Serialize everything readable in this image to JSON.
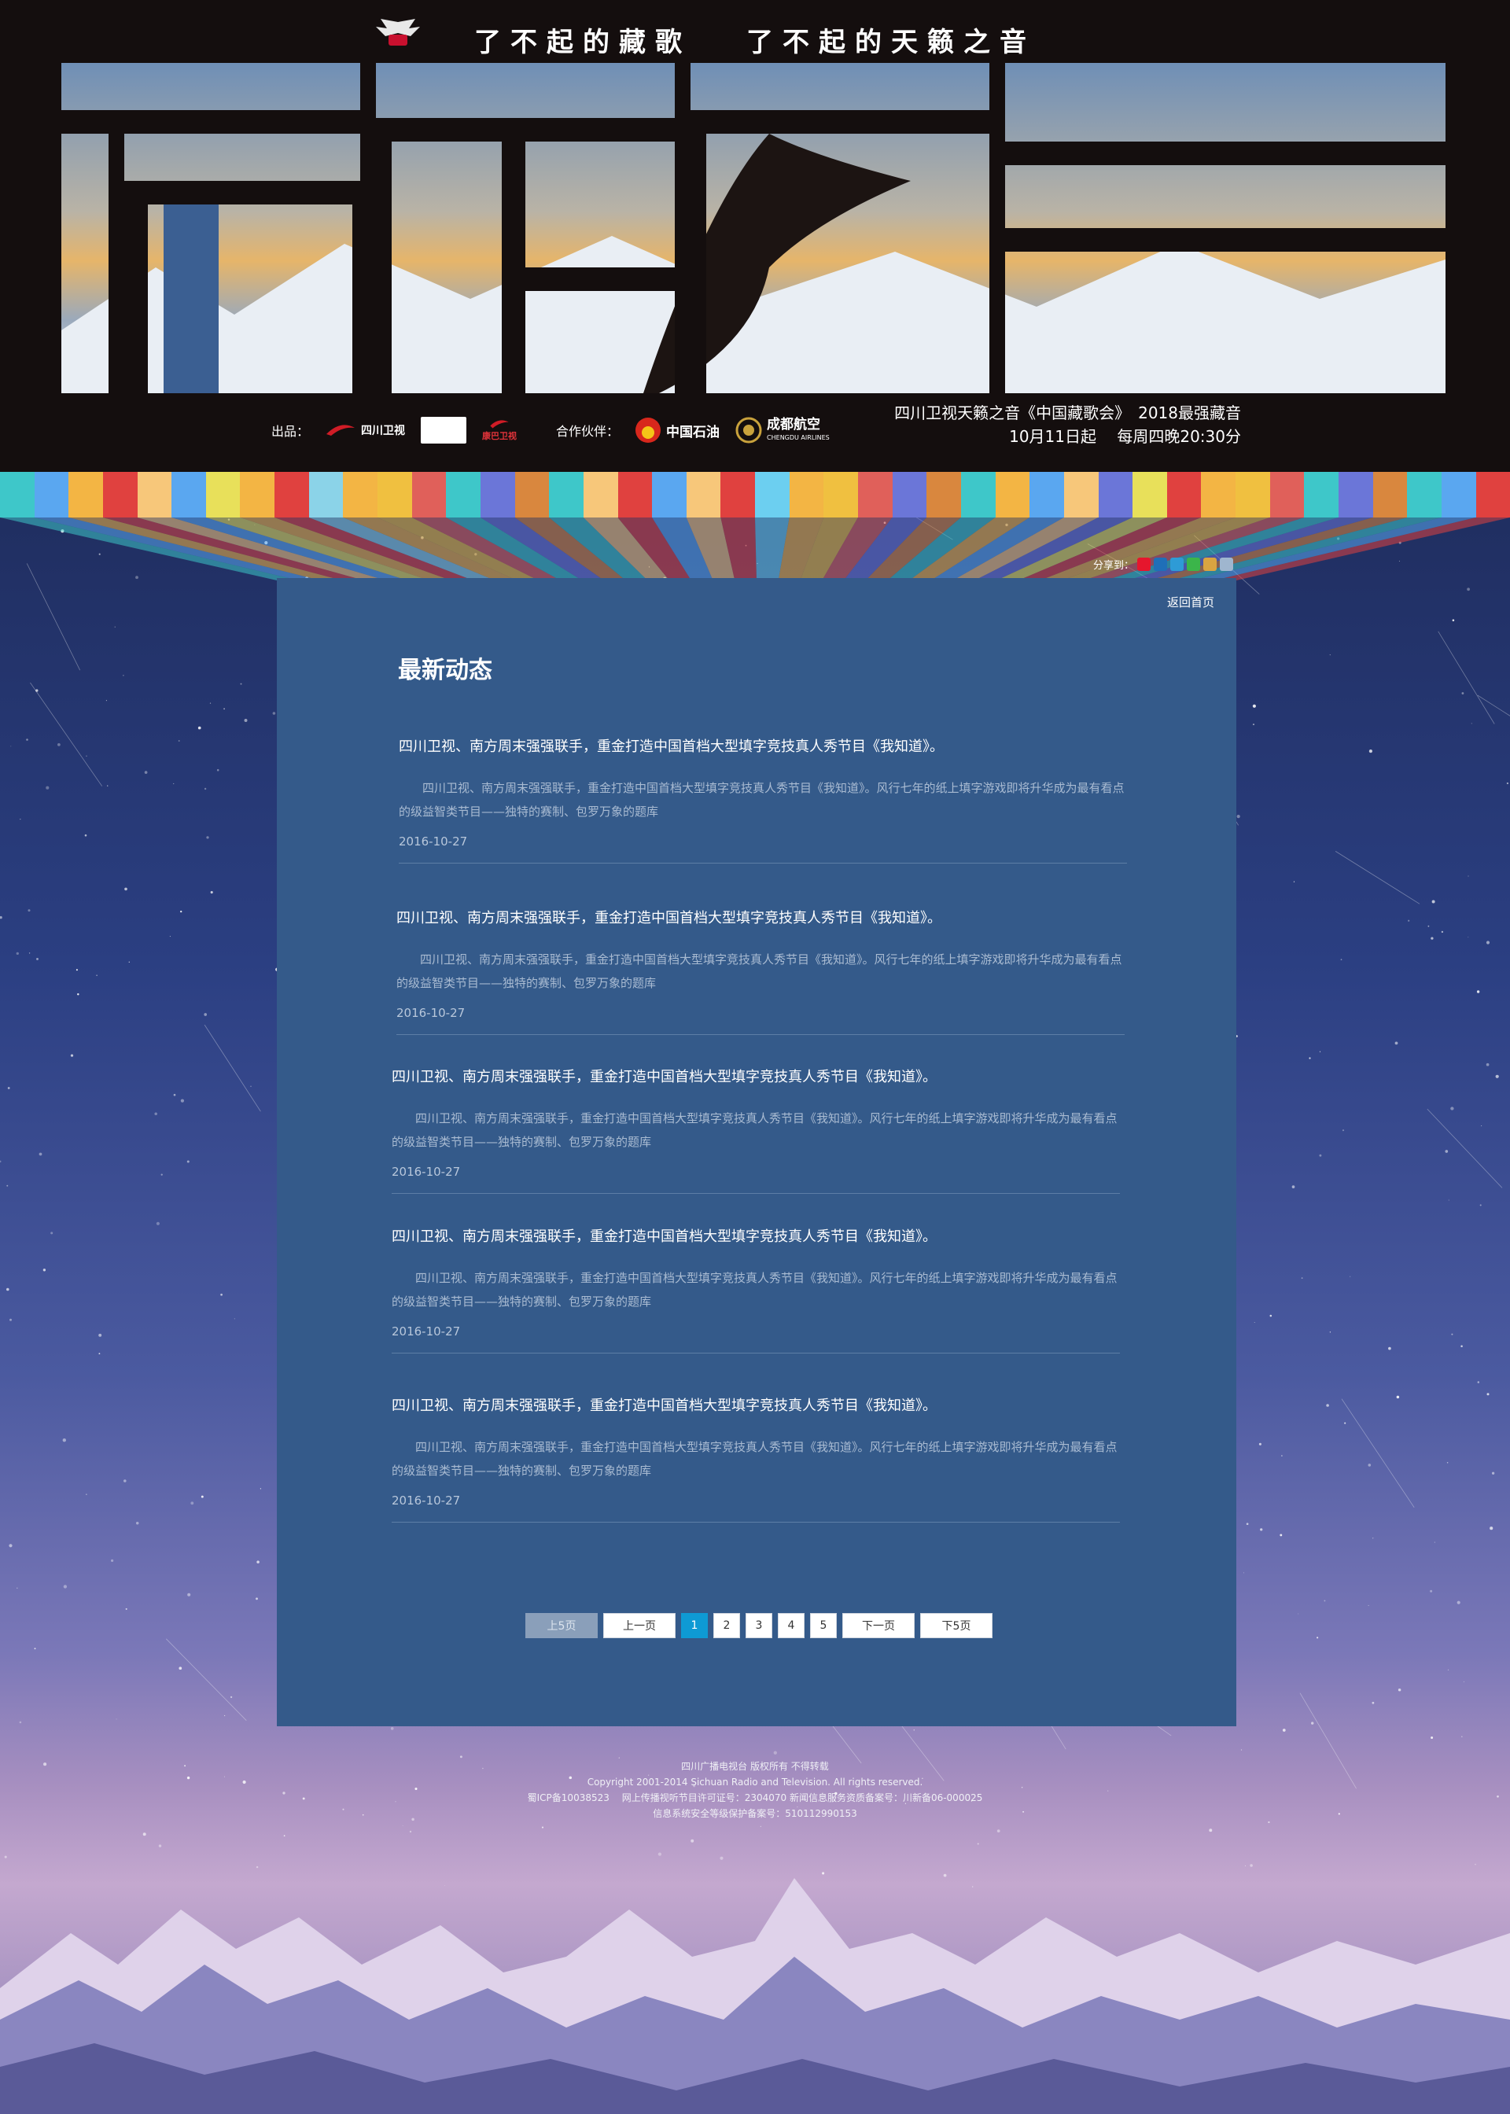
{
  "header": {
    "taglines": [
      "了不起的藏歌",
      "了不起的天籁之音"
    ],
    "credits_label": "出品：",
    "producers": [
      "四川卫视",
      "康巴卫视"
    ],
    "partners_label": "合作伙伴：",
    "partners": [
      "中国石油",
      "成都航空",
      "CHENGDU AIRLINES"
    ],
    "air_line1": "四川卫视天籁之音《中国藏歌会》　2018最强藏音",
    "air_line2": "10月11日起　 每周四晚20:30分"
  },
  "share": {
    "label": "分享到："
  },
  "panel": {
    "back_home": "返回首页",
    "section_title": "最新动态",
    "news": [
      {
        "title": "四川卫视、南方周末强强联手，重金打造中国首档大型填字竞技真人秀节目《我知道》。",
        "summary": "四川卫视、南方周末强强联手，重金打造中国首档大型填字竞技真人秀节目《我知道》。风行七年的纸上填字游戏即将升华成为最有看点的级益智类节目——独特的赛制、包罗万象的题库",
        "date": "2016-10-27"
      },
      {
        "title": "四川卫视、南方周末强强联手，重金打造中国首档大型填字竞技真人秀节目《我知道》。",
        "summary": "四川卫视、南方周末强强联手，重金打造中国首档大型填字竞技真人秀节目《我知道》。风行七年的纸上填字游戏即将升华成为最有看点的级益智类节目——独特的赛制、包罗万象的题库",
        "date": "2016-10-27"
      },
      {
        "title": "四川卫视、南方周末强强联手，重金打造中国首档大型填字竞技真人秀节目《我知道》。",
        "summary": "四川卫视、南方周末强强联手，重金打造中国首档大型填字竞技真人秀节目《我知道》。风行七年的纸上填字游戏即将升华成为最有看点的级益智类节目——独特的赛制、包罗万象的题库",
        "date": "2016-10-27"
      },
      {
        "title": "四川卫视、南方周末强强联手，重金打造中国首档大型填字竞技真人秀节目《我知道》。",
        "summary": "四川卫视、南方周末强强联手，重金打造中国首档大型填字竞技真人秀节目《我知道》。风行七年的纸上填字游戏即将升华成为最有看点的级益智类节目——独特的赛制、包罗万象的题库",
        "date": "2016-10-27"
      },
      {
        "title": "四川卫视、南方周末强强联手，重金打造中国首档大型填字竞技真人秀节目《我知道》。",
        "summary": "四川卫视、南方周末强强联手，重金打造中国首档大型填字竞技真人秀节目《我知道》。风行七年的纸上填字游戏即将升华成为最有看点的级益智类节目——独特的赛制、包罗万象的题库",
        "date": "2016-10-27"
      }
    ]
  },
  "pagination": {
    "prev5": "上5页",
    "prev": "上一页",
    "pages": [
      "1",
      "2",
      "3",
      "4",
      "5"
    ],
    "next": "下一页",
    "next5": "下5页"
  },
  "footer": {
    "line1": "四川广播电视台 版权所有 不得转载",
    "line2": "Copyright 2001-2014 Sichuan Radio and Television. All rights reserved.",
    "line3": "蜀ICP备10038523　 网上传播视听节目许可证号：2304070 新闻信息服务资质备案号：川新备06-000025",
    "line4": "信息系统安全等级保护备案号：510112990153"
  },
  "colors": {
    "panel_bg": "#345a8a",
    "active_page": "#0e9ad4",
    "header_bg": "#140e0e"
  }
}
